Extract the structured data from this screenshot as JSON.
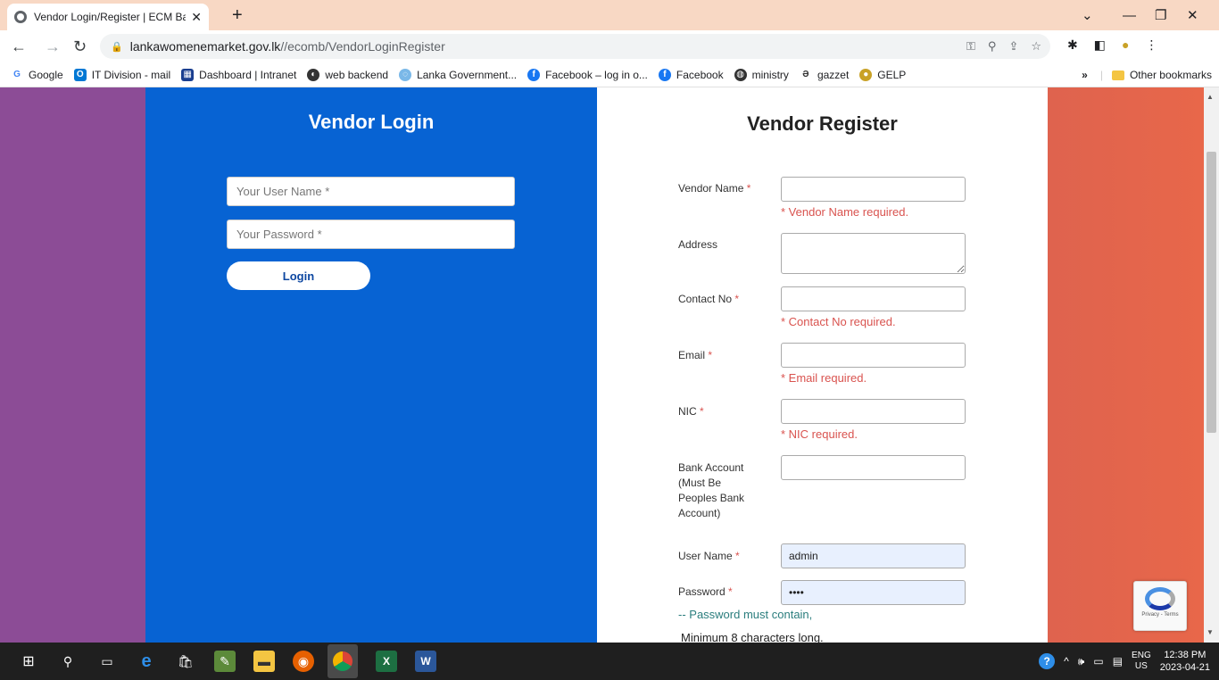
{
  "browser": {
    "tab_title": "Vendor Login/Register | ECM Bac",
    "tab_close": "✕",
    "new_tab": "+",
    "url_domain": "lankawomenemarket.gov.lk",
    "url_path": "//ecomb/VendorLoginRegister",
    "bookmarks": [
      {
        "label": "Google",
        "icon": "google-icon",
        "color": "#4285f4"
      },
      {
        "label": "IT Division - mail",
        "icon": "outlook-icon",
        "color": "#0078d4"
      },
      {
        "label": "Dashboard | Intranet",
        "icon": "dashboard-icon",
        "color": "#1a3e8f"
      },
      {
        "label": "web backend",
        "icon": "web-backend-icon",
        "color": "#333333"
      },
      {
        "label": "Lanka Government...",
        "icon": "lanka-gov-icon",
        "color": "#7ab8e8"
      },
      {
        "label": "Facebook – log in o...",
        "icon": "facebook-icon",
        "color": "#1877f2"
      },
      {
        "label": "Facebook",
        "icon": "facebook-icon",
        "color": "#1877f2"
      },
      {
        "label": "ministry",
        "icon": "globe-icon",
        "color": "#333333"
      },
      {
        "label": "gazzet",
        "icon": "gazzet-icon",
        "color": "#333333"
      },
      {
        "label": "GELP",
        "icon": "gelp-icon",
        "color": "#c9a227"
      }
    ],
    "more_bookmarks": "»",
    "other_bookmarks": "Other bookmarks"
  },
  "login": {
    "title": "Vendor Login",
    "username_placeholder": "Your User Name *",
    "password_placeholder": "Your Password *",
    "button": "Login"
  },
  "register": {
    "title": "Vendor Register",
    "vendor_name_label": "Vendor Name",
    "vendor_name_error": "* Vendor Name required.",
    "address_label": "Address",
    "contact_label": "Contact No",
    "contact_error": "* Contact No required.",
    "email_label": "Email",
    "email_error": "* Email required.",
    "nic_label": "NIC",
    "nic_error": "* NIC required.",
    "bank_label_1": "Bank Account",
    "bank_label_2": "(Must Be",
    "bank_label_3": "Peoples Bank",
    "bank_label_4": "Account)",
    "username_label": "User Name",
    "username_value": "admin",
    "password_label": "Password",
    "password_value": "••••",
    "password_note": "-- Password must contain,",
    "password_rule": "Minimum 8 characters long.",
    "required_mark": "*"
  },
  "recaptcha": {
    "text": "Privacy - Terms"
  },
  "taskbar": {
    "lang_top": "ENG",
    "lang_bottom": "US",
    "time": "12:38 PM",
    "date": "2023-04-21"
  },
  "colors": {
    "login_bg": "#0763d3",
    "error": "#d9534f",
    "note": "#2a7d7d"
  }
}
